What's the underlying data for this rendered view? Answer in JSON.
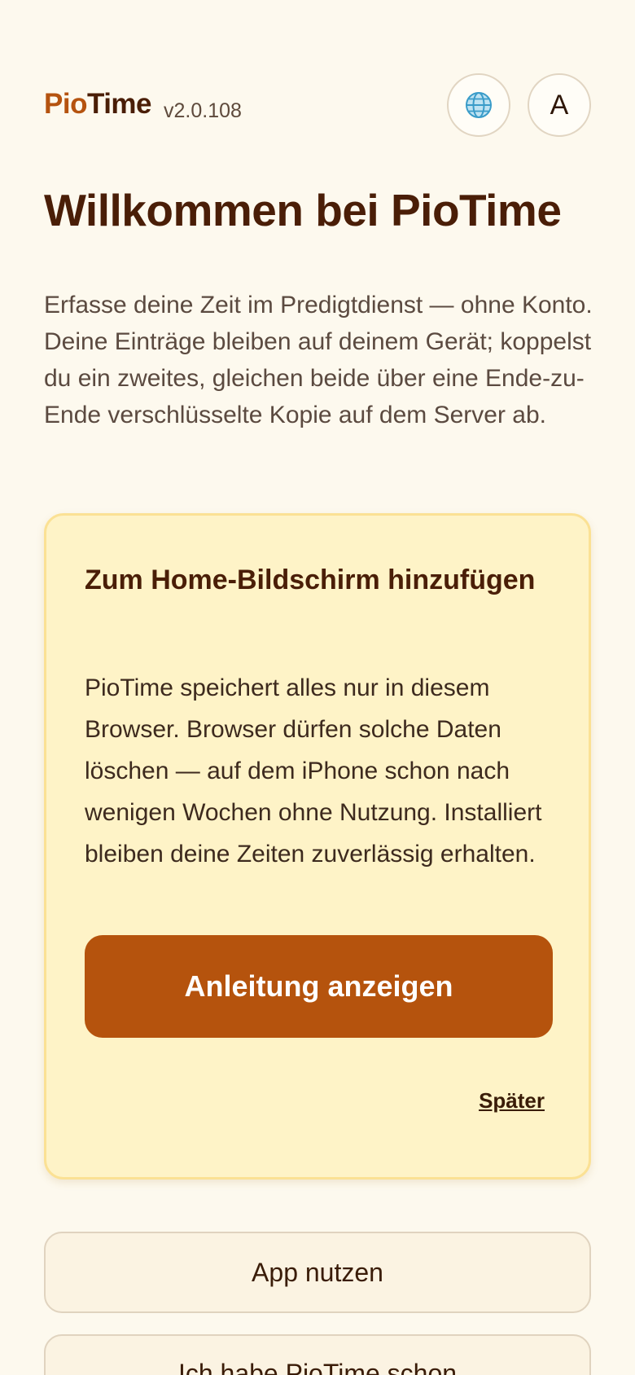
{
  "header": {
    "brand_part1": "Pio",
    "brand_part2": "Time",
    "version": "v2.0.108",
    "language_icon": "globe-icon",
    "avatar_letter": "A"
  },
  "welcome": {
    "title": "Willkommen bei PioTime",
    "intro": "Erfasse deine Zeit im Predigtdienst — ohne Konto. Deine Einträge bleiben auf deinem Gerät; koppelst du ein zweites, gleichen beide über eine Ende-zu-Ende verschlüsselte Kopie auf dem Server ab."
  },
  "install_card": {
    "title": "Zum Home-Bildschirm hinzufügen",
    "text": "PioTime speichert alles nur in diesem Browser. Browser dürfen solche Daten löschen — auf dem iPhone schon nach wenigen Wochen ohne Nutzung. Installiert bleiben deine Zeiten zuverlässig erhalten.",
    "primary_label": "Anleitung anzeigen",
    "later_label": "Später"
  },
  "actions": {
    "use_app_label": "App nutzen",
    "have_piotime_label": "Ich habe PioTime schon"
  },
  "colors": {
    "background": "#fdf9ee",
    "brand_accent": "#b5530f",
    "brand_dark": "#4a1e07",
    "card_background": "#fef3c7",
    "card_border": "#fbe194",
    "primary_button": "#b5530d"
  }
}
